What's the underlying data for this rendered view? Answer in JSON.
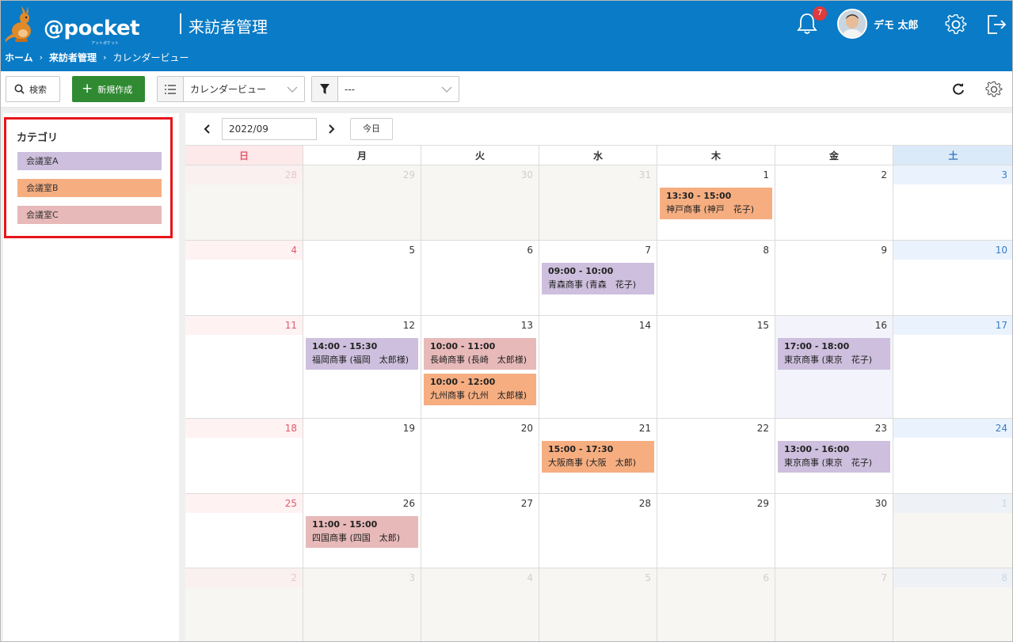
{
  "header": {
    "logo_text": "@pocket",
    "logo_sub": "アットポケット",
    "app_title": "来訪者管理",
    "notification_count": "7",
    "user_name": "デモ 太郎"
  },
  "breadcrumb": {
    "home": "ホーム",
    "section": "来訪者管理",
    "current": "カレンダービュー"
  },
  "toolbar": {
    "search_label": "検索",
    "new_label": "新規作成",
    "view_value": "カレンダービュー",
    "filter_value": "---"
  },
  "sidebar": {
    "title": "カテゴリ",
    "categories": [
      {
        "label": "会議室A",
        "color": "#cdbfdd"
      },
      {
        "label": "会議室B",
        "color": "#f6ae81"
      },
      {
        "label": "会議室C",
        "color": "#e8b9b9"
      }
    ]
  },
  "calendar": {
    "month": "2022/09",
    "today_label": "今日",
    "weekdays": [
      "日",
      "月",
      "火",
      "水",
      "木",
      "金",
      "土"
    ],
    "weeks": [
      [
        {
          "d": "28",
          "o": true
        },
        {
          "d": "29",
          "o": true
        },
        {
          "d": "30",
          "o": true
        },
        {
          "d": "31",
          "o": true
        },
        {
          "d": "1"
        },
        {
          "d": "2"
        },
        {
          "d": "3"
        }
      ],
      [
        {
          "d": "4"
        },
        {
          "d": "5"
        },
        {
          "d": "6"
        },
        {
          "d": "7"
        },
        {
          "d": "8"
        },
        {
          "d": "9"
        },
        {
          "d": "10"
        }
      ],
      [
        {
          "d": "11"
        },
        {
          "d": "12"
        },
        {
          "d": "13"
        },
        {
          "d": "14"
        },
        {
          "d": "15"
        },
        {
          "d": "16",
          "h": true
        },
        {
          "d": "17"
        }
      ],
      [
        {
          "d": "18"
        },
        {
          "d": "19"
        },
        {
          "d": "20"
        },
        {
          "d": "21"
        },
        {
          "d": "22"
        },
        {
          "d": "23"
        },
        {
          "d": "24"
        }
      ],
      [
        {
          "d": "25"
        },
        {
          "d": "26"
        },
        {
          "d": "27"
        },
        {
          "d": "28"
        },
        {
          "d": "29"
        },
        {
          "d": "30"
        },
        {
          "d": "1",
          "o": true
        }
      ],
      [
        {
          "d": "2",
          "o": true
        },
        {
          "d": "3",
          "o": true
        },
        {
          "d": "4",
          "o": true
        },
        {
          "d": "5",
          "o": true
        },
        {
          "d": "6",
          "o": true
        },
        {
          "d": "7",
          "o": true
        },
        {
          "d": "8",
          "o": true
        }
      ]
    ],
    "events": [
      {
        "week": 0,
        "day": 4,
        "slot": 0,
        "time": "13:30 - 15:00",
        "name": "神戸商事 (神戸　花子)",
        "cat": 1
      },
      {
        "week": 1,
        "day": 3,
        "slot": 0,
        "time": "09:00 - 10:00",
        "name": "青森商事 (青森　花子)",
        "cat": 0
      },
      {
        "week": 2,
        "day": 1,
        "slot": 0,
        "time": "14:00 - 15:30",
        "name": "福岡商事 (福岡　太郎様)",
        "cat": 0
      },
      {
        "week": 2,
        "day": 2,
        "slot": 0,
        "time": "10:00 - 11:00",
        "name": "長崎商事 (長崎　太郎様)",
        "cat": 2
      },
      {
        "week": 2,
        "day": 2,
        "slot": 1,
        "time": "10:00 - 12:00",
        "name": "九州商事 (九州　太郎様)",
        "cat": 1
      },
      {
        "week": 2,
        "day": 5,
        "slot": 0,
        "time": "17:00 - 18:00",
        "name": "東京商事 (東京　花子)",
        "cat": 0
      },
      {
        "week": 3,
        "day": 3,
        "slot": 0,
        "time": "15:00 - 17:30",
        "name": "大阪商事 (大阪　太郎)",
        "cat": 1
      },
      {
        "week": 3,
        "day": 5,
        "slot": 0,
        "time": "13:00 - 16:00",
        "name": "東京商事 (東京　花子)",
        "cat": 0
      },
      {
        "week": 4,
        "day": 1,
        "slot": 0,
        "time": "11:00 - 15:00",
        "name": "四国商事 (四国　太郎)",
        "cat": 2
      }
    ]
  }
}
